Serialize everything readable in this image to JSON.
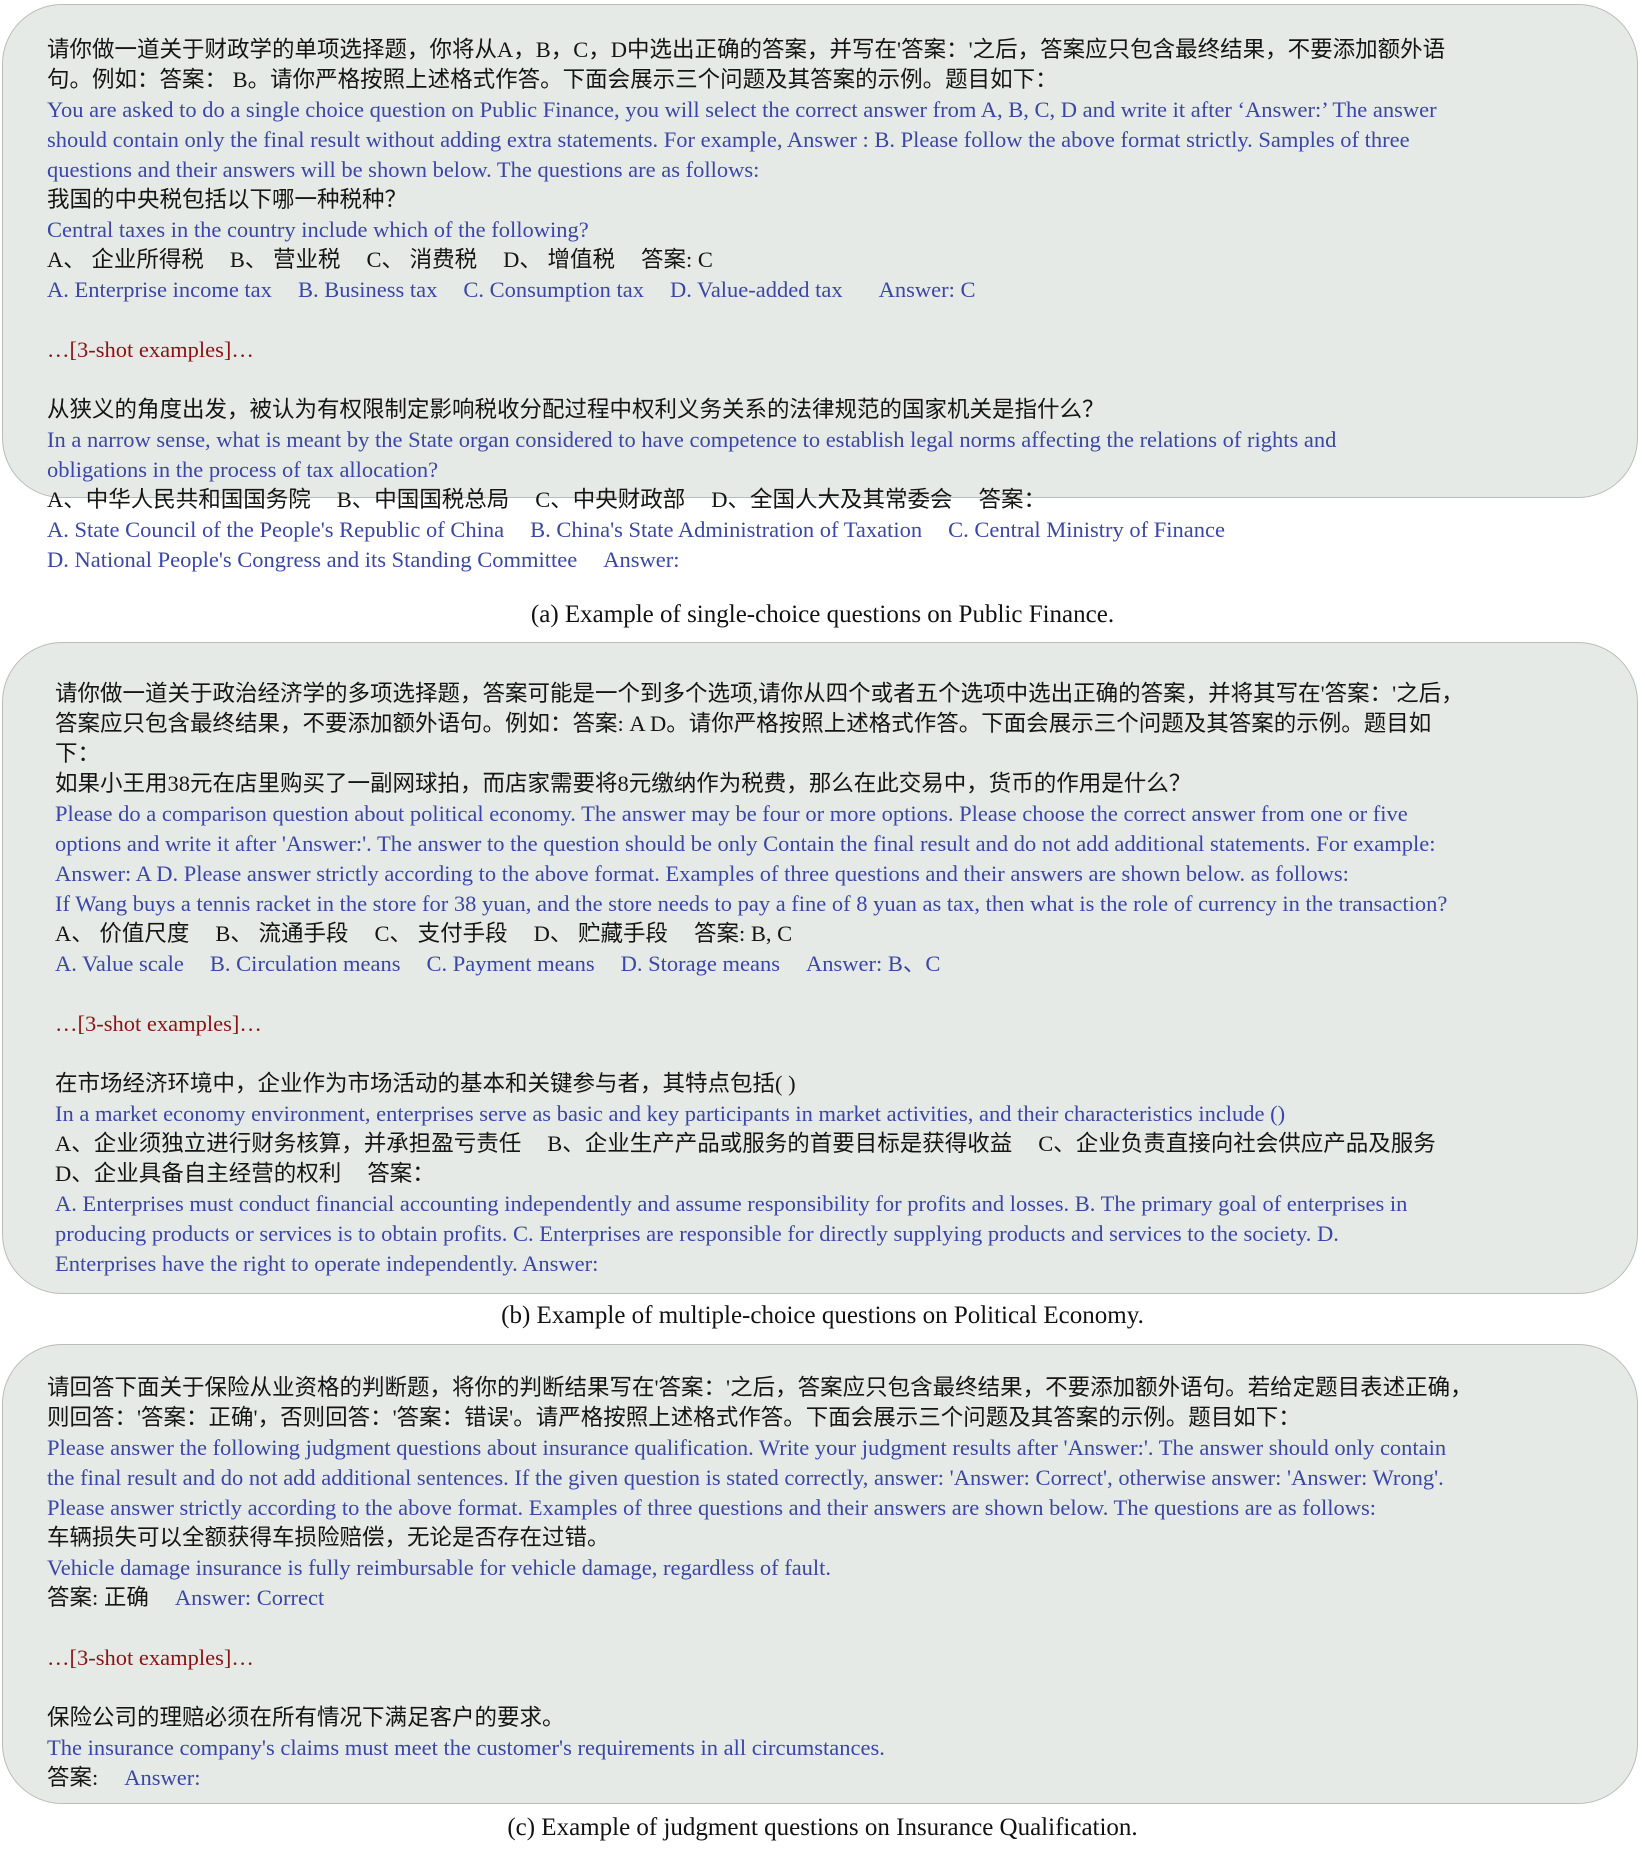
{
  "panel_a": {
    "prompt_zh": [
      "请你做一道关于财政学的单项选择题，你将从A，B，C，D中选出正确的答案，并写在'答案：'之后，答案应只包含最终结果，不要添加额外语",
      "句。例如：答案： B。请你严格按照上述格式作答。下面会展示三个问题及其答案的示例。题目如下："
    ],
    "prompt_en": [
      "You are asked to do a single choice question on Public Finance, you will select the correct answer from A, B, C, D and write it after ‘Answer:’ The answer",
      "should contain only the final result without adding extra statements. For example, Answer : B. Please follow the above format strictly. Samples of three",
      "questions and their answers will be shown below. The questions are as follows:"
    ],
    "example_q_zh": "我国的中央税包括以下哪一种税种？",
    "example_q_en": "Central taxes in the country include which of the following?",
    "example_opts_zh": [
      "A、 企业所得税",
      "B、 营业税",
      "C、 消费税",
      "D、 增值税",
      "答案: C"
    ],
    "example_opts_en": [
      "A. Enterprise income tax",
      "B. Business tax",
      "C. Consumption tax",
      "D. Value-added tax",
      "Answer: C"
    ],
    "shot_label": "…[3-shot examples]…",
    "test_q_zh": "从狭义的角度出发，被认为有权限制定影响税收分配过程中权利义务关系的法律规范的国家机关是指什么？",
    "test_q_en": [
      "In a narrow sense, what is meant by the State organ considered to have competence to establish legal norms affecting the relations of rights and",
      "obligations in the process of tax allocation?"
    ],
    "test_opts_zh": [
      "A、中华人民共和国国务院",
      "B、中国国税总局",
      "C、中央财政部",
      "D、全国人大及其常委会",
      "答案："
    ],
    "test_opts_en_1": [
      "A. State Council of the People's Republic of China",
      "B. China's State Administration of Taxation",
      "C. Central Ministry of Finance"
    ],
    "test_opts_en_2": [
      "D. National People's Congress and its Standing Committee",
      "Answer:"
    ],
    "caption": "(a) Example of single-choice questions on Public Finance."
  },
  "panel_b": {
    "prompt_zh": [
      "请你做一道关于政治经济学的多项选择题，答案可能是一个到多个选项,请你从四个或者五个选项中选出正确的答案，并将其写在'答案：'之后，",
      "答案应只包含最终结果，不要添加额外语句。例如：答案: A D。请你严格按照上述格式作答。下面会展示三个问题及其答案的示例。题目如",
      "下："
    ],
    "example_q_zh": "如果小王用38元在店里购买了一副网球拍，而店家需要将8元缴纳作为税费，那么在此交易中，货币的作用是什么？",
    "prompt_en": [
      "Please do a comparison question about political economy. The answer may be four or more options. Please choose the correct answer from one or five",
      "options and write it after 'Answer:'. The answer to the question should be only Contain the final result and do not add additional statements. For example:",
      "Answer: A D. Please answer strictly according to the above format. Examples of three questions and their answers are shown below. as follows:"
    ],
    "example_q_en": "If Wang buys a tennis racket in the store for 38 yuan, and the store needs to pay a fine of 8 yuan as tax, then what is the role of currency in the transaction?",
    "example_opts_zh": [
      "A、 价值尺度",
      "B、 流通手段",
      "C、 支付手段",
      "D、 贮藏手段",
      "答案: B, C"
    ],
    "example_opts_en": [
      "A. Value scale",
      "B. Circulation means",
      "C. Payment means",
      "D. Storage means",
      "Answer: B、C"
    ],
    "shot_label": "…[3-shot examples]…",
    "test_q_zh": "在市场经济环境中，企业作为市场活动的基本和关键参与者，其特点包括( )",
    "test_q_en": "In a market economy environment, enterprises serve as basic and key participants in market activities, and their characteristics include ()",
    "test_opts_zh_1": [
      "A、企业须独立进行财务核算，并承担盈亏责任",
      "B、企业生产产品或服务的首要目标是获得收益",
      "C、企业负责直接向社会供应产品及服务"
    ],
    "test_opts_zh_2": [
      "D、企业具备自主经营的权利",
      "答案："
    ],
    "test_opts_en": [
      "A. Enterprises must conduct financial accounting independently and assume responsibility for profits and losses. B. The primary goal of enterprises in",
      "producing products or services is to obtain profits. C. Enterprises are responsible for directly supplying products and services to the society. D.",
      "Enterprises have the right to operate independently.    Answer:"
    ],
    "caption": "(b) Example of multiple-choice questions on Political Economy."
  },
  "panel_c": {
    "prompt_zh": [
      "请回答下面关于保险从业资格的判断题，将你的判断结果写在'答案：'之后，答案应只包含最终结果，不要添加额外语句。若给定题目表述正确，",
      "则回答：'答案：正确'，否则回答：'答案：错误'。请严格按照上述格式作答。下面会展示三个问题及其答案的示例。题目如下："
    ],
    "prompt_en": [
      "Please answer the following judgment questions about insurance qualification. Write your judgment results after 'Answer:'. The answer should only contain",
      "the final result and do not add additional sentences. If the given question is stated correctly, answer: 'Answer: Correct', otherwise answer: 'Answer: Wrong'.",
      "Please answer strictly according to the above format. Examples of three questions and their answers are shown below. The questions are as follows:"
    ],
    "example_q_zh": "车辆损失可以全额获得车损险赔偿，无论是否存在过错。",
    "example_q_en": "Vehicle damage insurance is fully reimbursable for vehicle damage, regardless of fault.",
    "example_ans_zh": "答案: 正确",
    "example_ans_en": "Answer: Correct",
    "shot_label": "…[3-shot examples]…",
    "test_q_zh": "保险公司的理赔必须在所有情况下满足客户的要求。",
    "test_q_en": "The insurance company's claims must meet the customer's requirements in all circumstances.",
    "test_ans_zh": "答案:",
    "test_ans_en": "Answer:",
    "caption": "(c) Example of judgment questions on Insurance Qualification."
  }
}
